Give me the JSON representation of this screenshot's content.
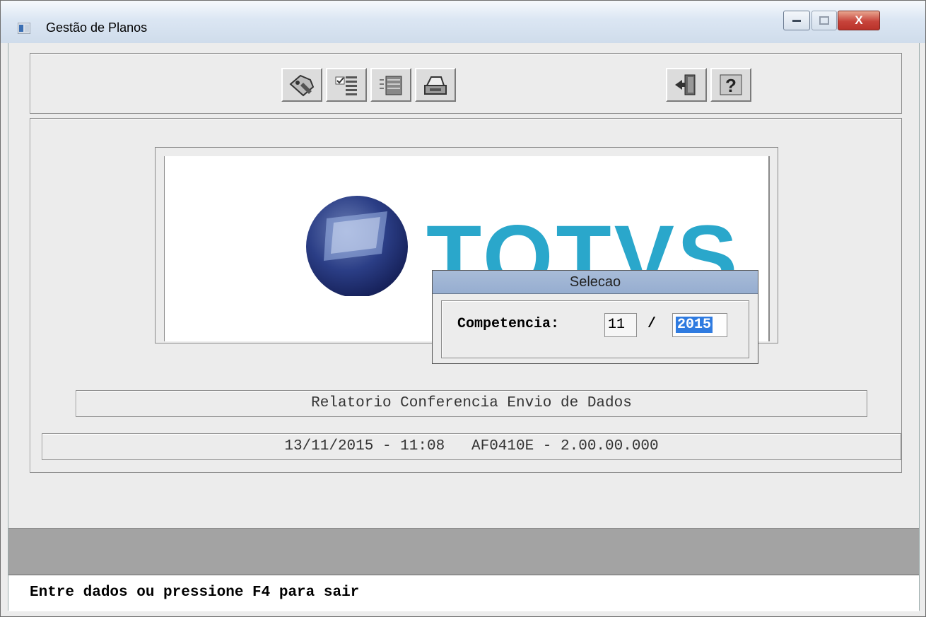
{
  "window": {
    "title": "Gestão de Planos",
    "controls": {
      "minimize": "minimize-icon",
      "maximize": "maximize-icon",
      "close": "X"
    }
  },
  "toolbar": {
    "buttons": [
      {
        "name": "tag-edit-icon"
      },
      {
        "name": "checklist-icon"
      },
      {
        "name": "list-icon"
      },
      {
        "name": "printer-icon"
      },
      {
        "name": "exit-door-icon"
      },
      {
        "name": "help-icon"
      }
    ]
  },
  "logo": {
    "text": "TOTVS",
    "color": "#2aa7cb"
  },
  "dialog": {
    "title": "Selecao",
    "label": "Competencia:",
    "month": "11",
    "separator": "/",
    "year": "2015"
  },
  "report_title": "Relatorio Conferencia Envio de Dados",
  "info_line": "13/11/2015 - 11:08   AF0410E - 2.00.00.000",
  "status_message": "Entre dados ou pressione F4 para sair"
}
